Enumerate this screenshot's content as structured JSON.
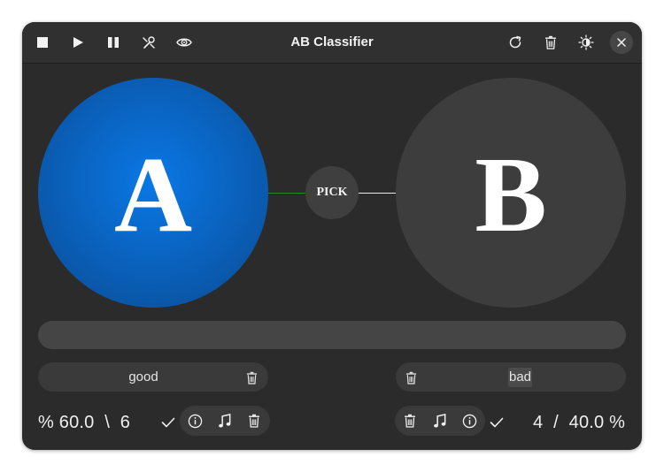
{
  "window": {
    "title": "AB Classifier"
  },
  "toolbar": {
    "left_icons": [
      "stop-icon",
      "play-icon",
      "pause-icon",
      "tools-icon",
      "eye-icon"
    ],
    "right_icons": [
      "refresh-icon",
      "trash-icon",
      "brightness-icon",
      "close-icon"
    ]
  },
  "choices": {
    "a": {
      "letter": "A",
      "color": "#0a6fd6"
    },
    "b": {
      "letter": "B",
      "color": "#3d3d3d"
    },
    "pick_label": "PICK"
  },
  "labels": {
    "a": {
      "value": "good"
    },
    "b": {
      "value": "bad"
    }
  },
  "stats": {
    "a": {
      "percent_symbol": "%",
      "percent": "60.0",
      "separator": "\\",
      "count": "6"
    },
    "b": {
      "count": "4",
      "separator": "/",
      "percent": "40.0",
      "percent_symbol": "%"
    }
  },
  "colors": {
    "accent": "#0a6fd6",
    "link_a": "#1a8a2a",
    "link_b": "#e8e8e8"
  }
}
